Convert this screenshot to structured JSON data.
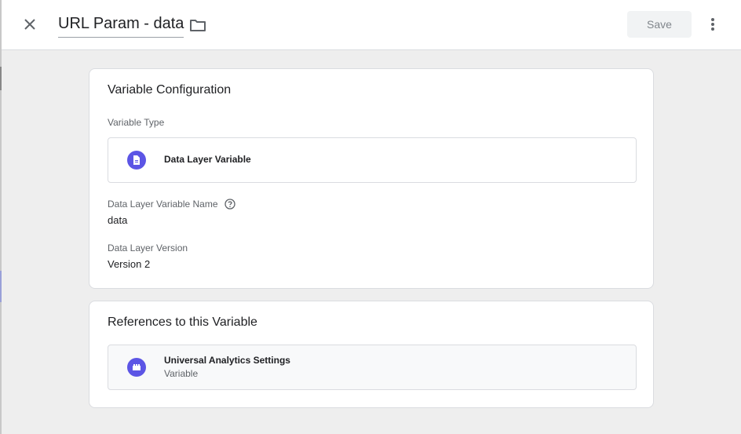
{
  "header": {
    "title": "URL Param - data",
    "save_label": "Save"
  },
  "config_card": {
    "title": "Variable Configuration",
    "type_label": "Variable Type",
    "type_name": "Data Layer Variable",
    "name_label": "Data Layer Variable Name",
    "name_value": "data",
    "version_label": "Data Layer Version",
    "version_value": "Version 2"
  },
  "references_card": {
    "title": "References to this Variable",
    "items": [
      {
        "name": "Universal Analytics Settings",
        "type": "Variable"
      }
    ]
  },
  "icons": {
    "close": "close-icon",
    "folder": "folder-icon",
    "more": "more-vert-icon",
    "variable_type": "document-icon",
    "help": "help-icon",
    "reference": "settings-variable-icon"
  },
  "colors": {
    "accent": "#5c55e5",
    "background": "#eeeeee",
    "card": "#ffffff",
    "save_bg": "#f1f3f4"
  }
}
